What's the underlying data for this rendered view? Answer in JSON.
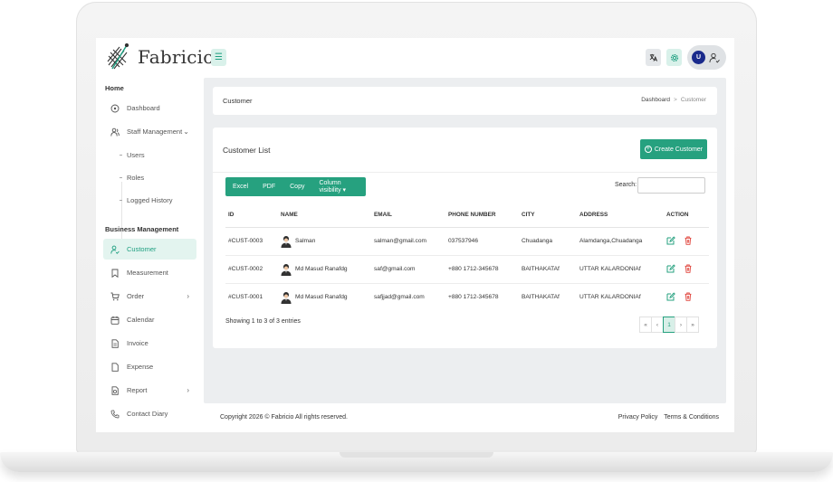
{
  "brand": {
    "name": "Fabricio"
  },
  "header": {
    "menu_icon": "hamburger-icon",
    "translate_icon": "translate-icon",
    "settings_icon": "gear-icon",
    "avatar_letter": "U",
    "user_icon": "user-switch-icon"
  },
  "sidebar": {
    "section_home": "Home",
    "dashboard": "Dashboard",
    "staff_management": "Staff Management",
    "users": "Users",
    "roles": "Roles",
    "logged_history": "Logged History",
    "section_business": "Business Management",
    "customer": "Customer",
    "measurement": "Measurement",
    "order": "Order",
    "calendar": "Calendar",
    "invoice": "Invoice",
    "expense": "Expense",
    "report": "Report",
    "contact_diary": "Contact Diary"
  },
  "breadcrumb": {
    "title": "Customer",
    "home": "Dashboard",
    "separator": ">",
    "current": "Customer"
  },
  "customer_list": {
    "title": "Customer List",
    "create_label": "Create Customer",
    "export_buttons": [
      "Excel",
      "PDF",
      "Copy",
      "Column visibility ▾"
    ],
    "search_label": "Search:",
    "search_value": "",
    "columns": [
      "ID",
      "NAME",
      "EMAIL",
      "PHONE NUMBER",
      "CITY",
      "ADDRESS",
      "ACTION"
    ],
    "rows": [
      {
        "id": "#CUST-0003",
        "name": "Salman",
        "email": "salman@gmail.com",
        "phone": "037537946",
        "city": "Chuadanga",
        "address": "Alamdanga,Chuadanga"
      },
      {
        "id": "#CUST-0002",
        "name": "Md Masud Ranafdg",
        "email": "saf@gmail.com",
        "phone": "+880 1712-345678",
        "city": "BAITHAKATAf",
        "address": "UTTAR KALARDONIAf"
      },
      {
        "id": "#CUST-0001",
        "name": "Md Masud Ranafdg",
        "email": "safjjad@gmail.com",
        "phone": "+880 1712-345678",
        "city": "BAITHAKATAf",
        "address": "UTTAR KALARDONIAf"
      }
    ],
    "showing": "Showing 1 to 3 of 3 entries",
    "pager": {
      "first": "«",
      "prev": "‹",
      "page": "1",
      "next": "›",
      "last": "»"
    }
  },
  "footer": {
    "copyright": "Copyright 2026 © Fabricio All rights reserved.",
    "privacy": "Privacy Policy",
    "terms": "Terms & Conditions"
  },
  "colors": {
    "accent": "#26a17f",
    "accent_light": "#e3f4ef",
    "danger": "#e0443c",
    "avatar": "#1a2a8c",
    "page_bg": "#eceef0"
  }
}
